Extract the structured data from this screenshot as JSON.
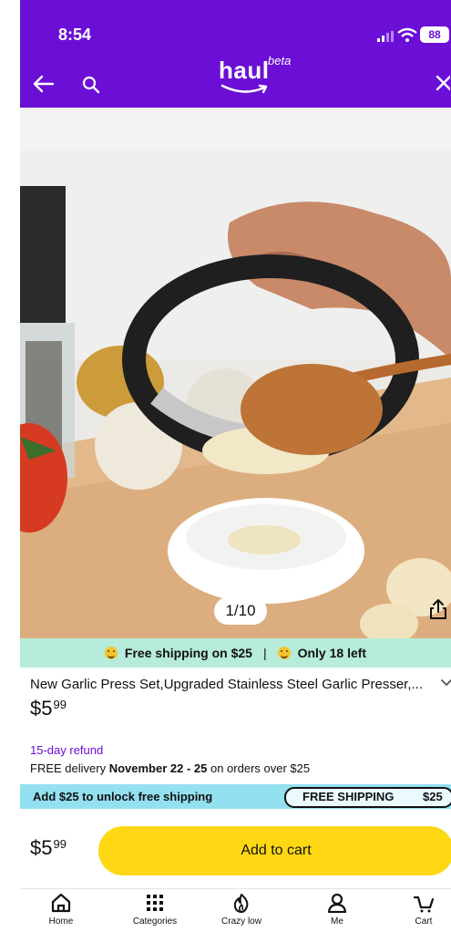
{
  "status_bar": {
    "time": "8:54",
    "battery": "88"
  },
  "header": {
    "logo_word": "haul",
    "logo_tag": "beta",
    "icons": [
      "back-arrow-icon",
      "search-icon",
      "close-icon"
    ]
  },
  "gallery": {
    "counter": "1/10",
    "current": 1,
    "total": 10,
    "share_icon": "share-icon"
  },
  "promo": {
    "free_shipping": "Free shipping on $25",
    "stock": "Only 18 left"
  },
  "product": {
    "title": "New Garlic Press Set,Upgraded Stainless Steel Garlic Presser,...",
    "price_dollars": "$5",
    "price_cents": "99",
    "refund": "15-day refund",
    "delivery_prefix": "FREE delivery ",
    "delivery_dates": "November 22 - 25",
    "delivery_suffix": " on orders over $25"
  },
  "shipping_bar": {
    "message": "Add $25 to unlock free shipping",
    "badge_label": "FREE SHIPPING",
    "badge_amount": "$25"
  },
  "cart": {
    "price_dollars": "$5",
    "price_cents": "99",
    "button_label": "Add to cart"
  },
  "nav": {
    "items": [
      {
        "label": "Home",
        "icon": "home-icon"
      },
      {
        "label": "Categories",
        "icon": "grid-icon"
      },
      {
        "label": "Crazy low",
        "icon": "flame-icon"
      },
      {
        "label": "Me",
        "icon": "person-icon"
      },
      {
        "label": "Cart",
        "icon": "cart-icon"
      }
    ]
  },
  "colors": {
    "brand": "#6b0fd6",
    "promo": "#b6ecd9",
    "ship_bar": "#93e0f0",
    "cta": "#ffd814"
  }
}
